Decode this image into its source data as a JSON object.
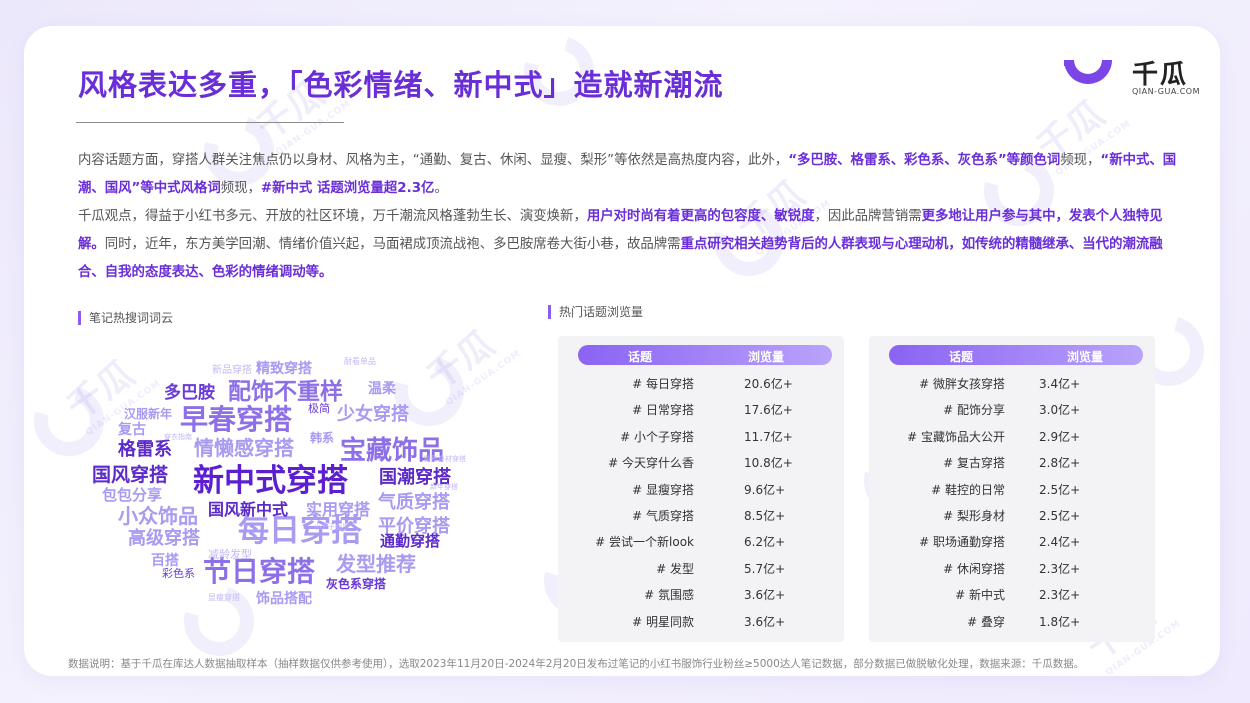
{
  "header": {
    "title": "风格表达多重，「色彩情绪、新中式」造就新潮流",
    "brand_name": "千瓜",
    "brand_url": "QIAN-GUA.COM"
  },
  "watermark": {
    "text": "千瓜",
    "sub": "QIAN-GUA.COM"
  },
  "intro": {
    "p1": [
      {
        "t": "内容话题方面，穿搭人群关注焦点仍以身材、风格为主，“通勤、复古、休闲、显瘦、梨形”等依然是高热度内容，此外，",
        "h": false
      },
      {
        "t": "“多巴胺、格雷系、彩色系、灰色系”等颜色词",
        "h": true
      },
      {
        "t": "频现，",
        "h": false
      },
      {
        "t": "“新中式、国潮、国风”等中式风格词",
        "h": true
      },
      {
        "t": "频现，",
        "h": false
      },
      {
        "t": "#新中式 话题浏览量超2.3亿",
        "h": true
      },
      {
        "t": "。",
        "h": false
      }
    ],
    "p2": [
      {
        "t": "千瓜观点，得益于小红书多元、开放的社区环境，万千潮流风格蓬勃生长、演变焕新，",
        "h": false
      },
      {
        "t": "用户对时尚有着更高的包容度、敏锐度",
        "h": true
      },
      {
        "t": "，因此品牌营销需",
        "h": false
      },
      {
        "t": "更多地让用户参与其中，发表个人独特见解。",
        "h": true
      },
      {
        "t": "同时，近年，东方美学回潮、情绪价值兴起，马面裙成顶流战袍、多巴胺席卷大街小巷，故品牌需",
        "h": false
      },
      {
        "t": "重点研究相关趋势背后的人群表现与心理动机，如传统的精髓继承、当代的潮流融合、自我的态度表达、色彩的情绪调动等。",
        "h": true
      }
    ]
  },
  "wordcloud": {
    "label": "笔记热搜词词云",
    "words": [
      {
        "w": "新中式穿搭",
        "c": "#5b1fcf"
      },
      {
        "w": "每日穿搭",
        "c": "#a99af2"
      },
      {
        "w": "早春穿搭",
        "c": "#8d6fe8"
      },
      {
        "w": "节日穿搭",
        "c": "#8d6fe8"
      },
      {
        "w": "宝藏饰品",
        "c": "#8d6fe8"
      },
      {
        "w": "配饰不重样",
        "c": "#8d6fe8"
      },
      {
        "w": "情懒感穿搭",
        "c": "#a99af2"
      },
      {
        "w": "国风穿搭",
        "c": "#5b2ac8"
      },
      {
        "w": "国潮穿搭",
        "c": "#5b2ac8"
      },
      {
        "w": "小众饰品",
        "c": "#a99af2"
      },
      {
        "w": "少女穿搭",
        "c": "#a99af2"
      },
      {
        "w": "格雷系",
        "c": "#5b2ac8"
      },
      {
        "w": "多巴胺",
        "c": "#6a3ad8"
      },
      {
        "w": "国风新中式",
        "c": "#5b2ac8"
      },
      {
        "w": "气质穿搭",
        "c": "#a99af2"
      },
      {
        "w": "平价穿搭",
        "c": "#a99af2"
      },
      {
        "w": "发型推荐",
        "c": "#a99af2"
      },
      {
        "w": "高级穿搭",
        "c": "#a99af2"
      },
      {
        "w": "实用穿搭",
        "c": "#a99af2"
      },
      {
        "w": "通勤穿搭",
        "c": "#5b2ac8"
      },
      {
        "w": "包包分享",
        "c": "#a99af2"
      },
      {
        "w": "精致穿搭",
        "c": "#a99af2"
      },
      {
        "w": "温柔",
        "c": "#a99af2"
      },
      {
        "w": "复古",
        "c": "#a99af2"
      },
      {
        "w": "汉服新年",
        "c": "#a99af2"
      },
      {
        "w": "韩系",
        "c": "#a99af2"
      },
      {
        "w": "极简",
        "c": "#6a3ad8"
      },
      {
        "w": "灰色系穿搭",
        "c": "#6a3ad8"
      },
      {
        "w": "饰品搭配",
        "c": "#a99af2"
      },
      {
        "w": "百搭",
        "c": "#a99af2"
      },
      {
        "w": "彩色系",
        "c": "#6a3ad8"
      },
      {
        "w": "减龄发型",
        "c": "#c3b8f5"
      },
      {
        "w": "新品穿搭",
        "c": "#c3b8f5"
      },
      {
        "w": "耐看单品",
        "c": "#c3b8f5"
      },
      {
        "w": "穿衣指南",
        "c": "#c3b8f5"
      },
      {
        "w": "梨形身材穿搭",
        "c": "#c3b8f5"
      },
      {
        "w": "显瘦穿搭",
        "c": "#c3b8f5"
      },
      {
        "w": "新年穿搭",
        "c": "#c3b8f5"
      },
      {
        "w": "小个子女生",
        "c": "#c3b8f5"
      }
    ]
  },
  "topics": {
    "label": "热门话题浏览量",
    "col_topic": "话题",
    "col_views": "浏览量",
    "left": [
      {
        "topic": "# 每日穿搭",
        "views": "20.6亿+"
      },
      {
        "topic": "# 日常穿搭",
        "views": "17.6亿+"
      },
      {
        "topic": "# 小个子穿搭",
        "views": "11.7亿+"
      },
      {
        "topic": "# 今天穿什么香",
        "views": "10.8亿+"
      },
      {
        "topic": "# 显瘦穿搭",
        "views": "9.6亿+"
      },
      {
        "topic": "# 气质穿搭",
        "views": "8.5亿+"
      },
      {
        "topic": "# 尝试一个新look",
        "views": "6.2亿+"
      },
      {
        "topic": "# 发型",
        "views": "5.7亿+"
      },
      {
        "topic": "# 氛围感",
        "views": "3.6亿+"
      },
      {
        "topic": "# 明星同款",
        "views": "3.6亿+"
      }
    ],
    "right": [
      {
        "topic": "# 微胖女孩穿搭",
        "views": "3.4亿+"
      },
      {
        "topic": "# 配饰分享",
        "views": "3.0亿+"
      },
      {
        "topic": "# 宝藏饰品大公开",
        "views": "2.9亿+"
      },
      {
        "topic": "# 复古穿搭",
        "views": "2.8亿+"
      },
      {
        "topic": "# 鞋控的日常",
        "views": "2.5亿+"
      },
      {
        "topic": "# 梨形身材",
        "views": "2.5亿+"
      },
      {
        "topic": "# 职场通勤穿搭",
        "views": "2.4亿+"
      },
      {
        "topic": "# 休闲穿搭",
        "views": "2.3亿+"
      },
      {
        "topic": "# 新中式",
        "views": "2.3亿+"
      },
      {
        "topic": "# 叠穿",
        "views": "1.8亿+"
      }
    ]
  },
  "footnote": "数据说明：基于千瓜在库达人数据抽取样本（抽样数据仅供参考使用），选取2023年11月20日-2024年2月20日发布过笔记的小红书服饰行业粉丝≥5000达人笔记数据，部分数据已做脱敏化处理，数据来源：千瓜数据。",
  "colors": {
    "accent": "#6a2ed8",
    "accent_light": "#a99af2",
    "table_bg": "#f3f3f6"
  }
}
